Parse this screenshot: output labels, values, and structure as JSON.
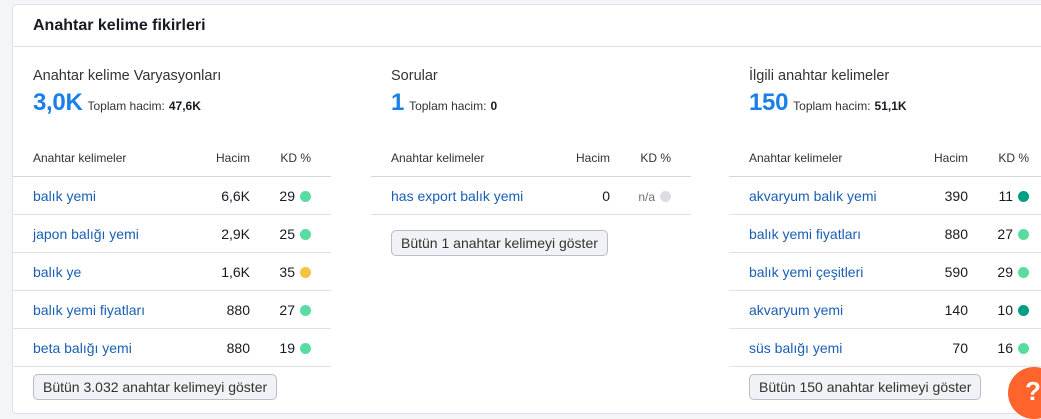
{
  "title": "Anahtar kelime fikirleri",
  "columns": {
    "variations": {
      "title": "Anahtar kelime Varyasyonları",
      "count": "3,0K",
      "total_label": "Toplam hacim:",
      "total_value": "47,6K",
      "headers": {
        "keyword": "Anahtar kelimeler",
        "volume": "Hacim",
        "kd": "KD %"
      },
      "rows": [
        {
          "keyword": "balık yemi",
          "volume": "6,6K",
          "kd": "29",
          "kd_color": "#59dca0"
        },
        {
          "keyword": "japon balığı yemi",
          "volume": "2,9K",
          "kd": "25",
          "kd_color": "#59dca0"
        },
        {
          "keyword": "balık ye",
          "volume": "1,6K",
          "kd": "35",
          "kd_color": "#f5c242"
        },
        {
          "keyword": "balık yemi fiyatları",
          "volume": "880",
          "kd": "27",
          "kd_color": "#59dca0"
        },
        {
          "keyword": "beta balığı yemi",
          "volume": "880",
          "kd": "19",
          "kd_color": "#59dca0"
        }
      ],
      "button": "Bütün 3.032 anahtar kelimeyi göster"
    },
    "questions": {
      "title": "Sorular",
      "count": "1",
      "total_label": "Toplam hacim:",
      "total_value": "0",
      "headers": {
        "keyword": "Anahtar kelimeler",
        "volume": "Hacim",
        "kd": "KD %"
      },
      "rows": [
        {
          "keyword": "has export balık yemi",
          "volume": "0",
          "kd": "n/a",
          "kd_color": "#dcdde3"
        }
      ],
      "button": "Bütün 1 anahtar kelimeyi göster"
    },
    "related": {
      "title": "İlgili anahtar kelimeler",
      "count": "150",
      "total_label": "Toplam hacim:",
      "total_value": "51,1K",
      "headers": {
        "keyword": "Anahtar kelimeler",
        "volume": "Hacim",
        "kd": "KD %"
      },
      "rows": [
        {
          "keyword": "akvaryum balık yemi",
          "volume": "390",
          "kd": "11",
          "kd_color": "#009f81"
        },
        {
          "keyword": "balık yemi fiyatları",
          "volume": "880",
          "kd": "27",
          "kd_color": "#59dca0"
        },
        {
          "keyword": "balık yemi çeşitleri",
          "volume": "590",
          "kd": "29",
          "kd_color": "#59dca0"
        },
        {
          "keyword": "akvaryum yemi",
          "volume": "140",
          "kd": "10",
          "kd_color": "#009f81"
        },
        {
          "keyword": "süs balığı yemi",
          "volume": "70",
          "kd": "16",
          "kd_color": "#59dca0"
        }
      ],
      "button": "Bütün 150 anahtar kelimeyi göster"
    }
  },
  "help": {
    "icon": "question-icon",
    "label": "?",
    "color": "#ff642d"
  }
}
